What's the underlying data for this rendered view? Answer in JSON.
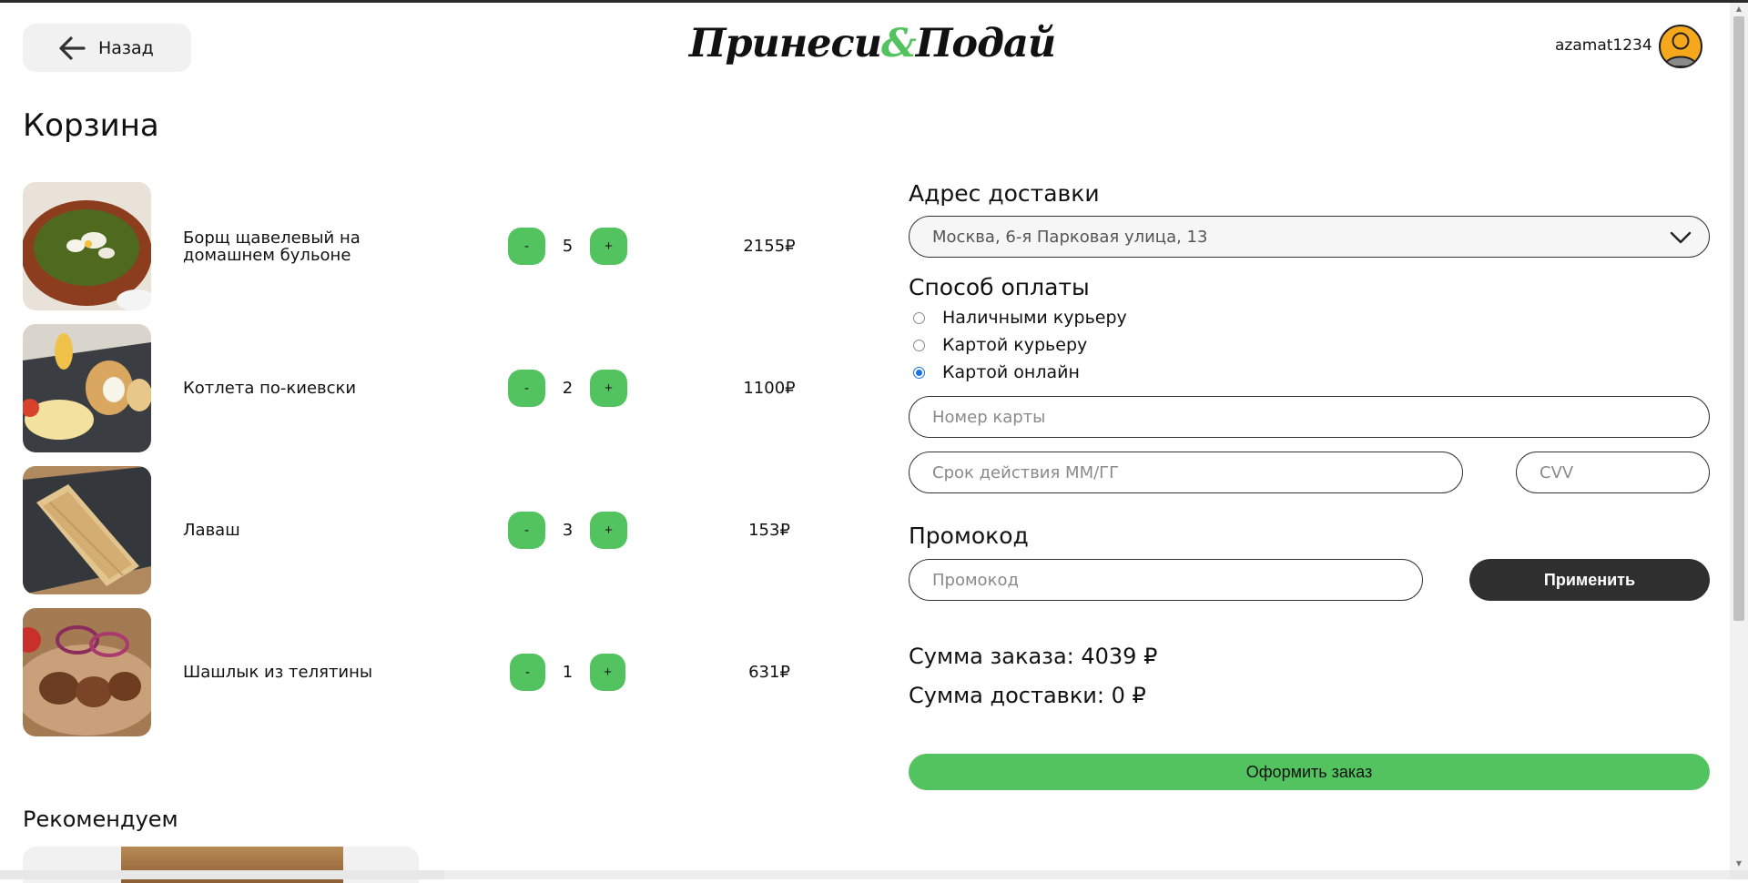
{
  "header": {
    "back_label": "Назад",
    "logo_part1": "Принеси",
    "logo_amp": "&",
    "logo_part2": "Подай",
    "username": "azamat1234"
  },
  "page_title": "Корзина",
  "cart": {
    "items": [
      {
        "name": "Борщ щавелевый на домашнем бульоне",
        "qty": "5",
        "price": "2155₽",
        "minus": "-",
        "plus": "+"
      },
      {
        "name": "Котлета по-киевски",
        "qty": "2",
        "price": "1100₽",
        "minus": "-",
        "plus": "+"
      },
      {
        "name": "Лаваш",
        "qty": "3",
        "price": "153₽",
        "minus": "-",
        "plus": "+"
      },
      {
        "name": "Шашлык из телятины",
        "qty": "1",
        "price": "631₽",
        "minus": "-",
        "plus": "+"
      }
    ]
  },
  "recommend_title": "Рекомендуем",
  "delivery": {
    "title": "Адрес доставки",
    "address_value": "Москва, 6-я Парковая улица, 13"
  },
  "payment": {
    "title": "Способ оплаты",
    "options": [
      "Наличными курьеру",
      "Картой курьеру",
      "Картой онлайн"
    ],
    "selected": "Картой онлайн",
    "card_number_placeholder": "Номер карты",
    "expiry_placeholder": "Срок действия ММ/ГГ",
    "cvv_placeholder": "CVV"
  },
  "promo": {
    "title": "Промокод",
    "placeholder": "Промокод",
    "apply_label": "Применить"
  },
  "totals": {
    "order_sum": "Сумма заказа: 4039 ₽",
    "delivery_sum": "Сумма доставки: 0 ₽"
  },
  "submit_label": "Оформить заказ",
  "colors": {
    "accent_green": "#52c35e",
    "dark_button": "#2f2f2f",
    "avatar": "#f6a81c",
    "radio_selected": "#1a73e8"
  },
  "icons": {
    "back": "arrow-left-icon",
    "avatar": "user-avatar-icon",
    "select": "chevron-down-icon"
  }
}
